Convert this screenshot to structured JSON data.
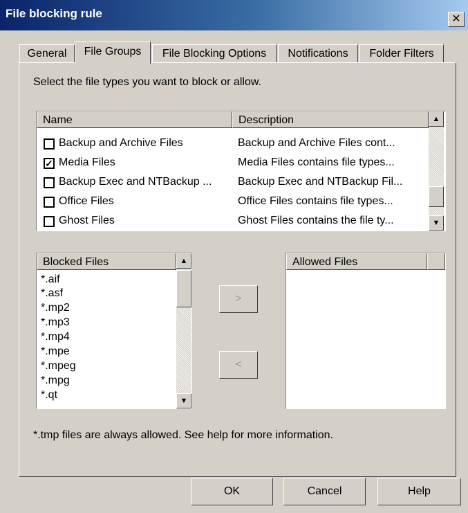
{
  "window": {
    "title": "File blocking rule",
    "close_glyph": "✕"
  },
  "tabs": [
    {
      "label": "General"
    },
    {
      "label": "File Groups",
      "active": true
    },
    {
      "label": "File Blocking Options"
    },
    {
      "label": "Notifications"
    },
    {
      "label": "Folder Filters"
    }
  ],
  "instruction": "Select the file types you want to block or allow.",
  "groups_table": {
    "columns": [
      "Name",
      "Description"
    ],
    "rows": [
      {
        "name": "Backup and Archive Files",
        "description": "Backup and Archive Files cont...",
        "checked": false
      },
      {
        "name": "Media Files",
        "description": "Media Files contains file types...",
        "checked": true
      },
      {
        "name": "Backup Exec and NTBackup ...",
        "description": "Backup Exec and NTBackup Fil...",
        "checked": false
      },
      {
        "name": "Office Files",
        "description": "Office Files contains file types...",
        "checked": false
      },
      {
        "name": "Ghost Files",
        "description": "Ghost Files contains the file ty...",
        "checked": false
      }
    ]
  },
  "blocked_files": {
    "header": "Blocked Files",
    "items": [
      "*.aif",
      "*.asf",
      "*.mp2",
      "*.mp3",
      "*.mp4",
      "*.mpe",
      "*.mpeg",
      "*.mpg",
      "*.qt"
    ]
  },
  "allowed_files": {
    "header": "Allowed Files",
    "items": []
  },
  "move_buttons": {
    "to_allowed": ">",
    "to_blocked": "<"
  },
  "note": "*.tmp files are always allowed. See help for more information.",
  "buttons": {
    "ok": "OK",
    "cancel": "Cancel",
    "help": "Help"
  },
  "icons": {
    "scroll_up": "▲",
    "scroll_down": "▼",
    "check": "✓"
  },
  "colors": {
    "titlebar_start": "#0a246a",
    "titlebar_end": "#a6caf0",
    "dialog_face": "#d4d0c8"
  }
}
